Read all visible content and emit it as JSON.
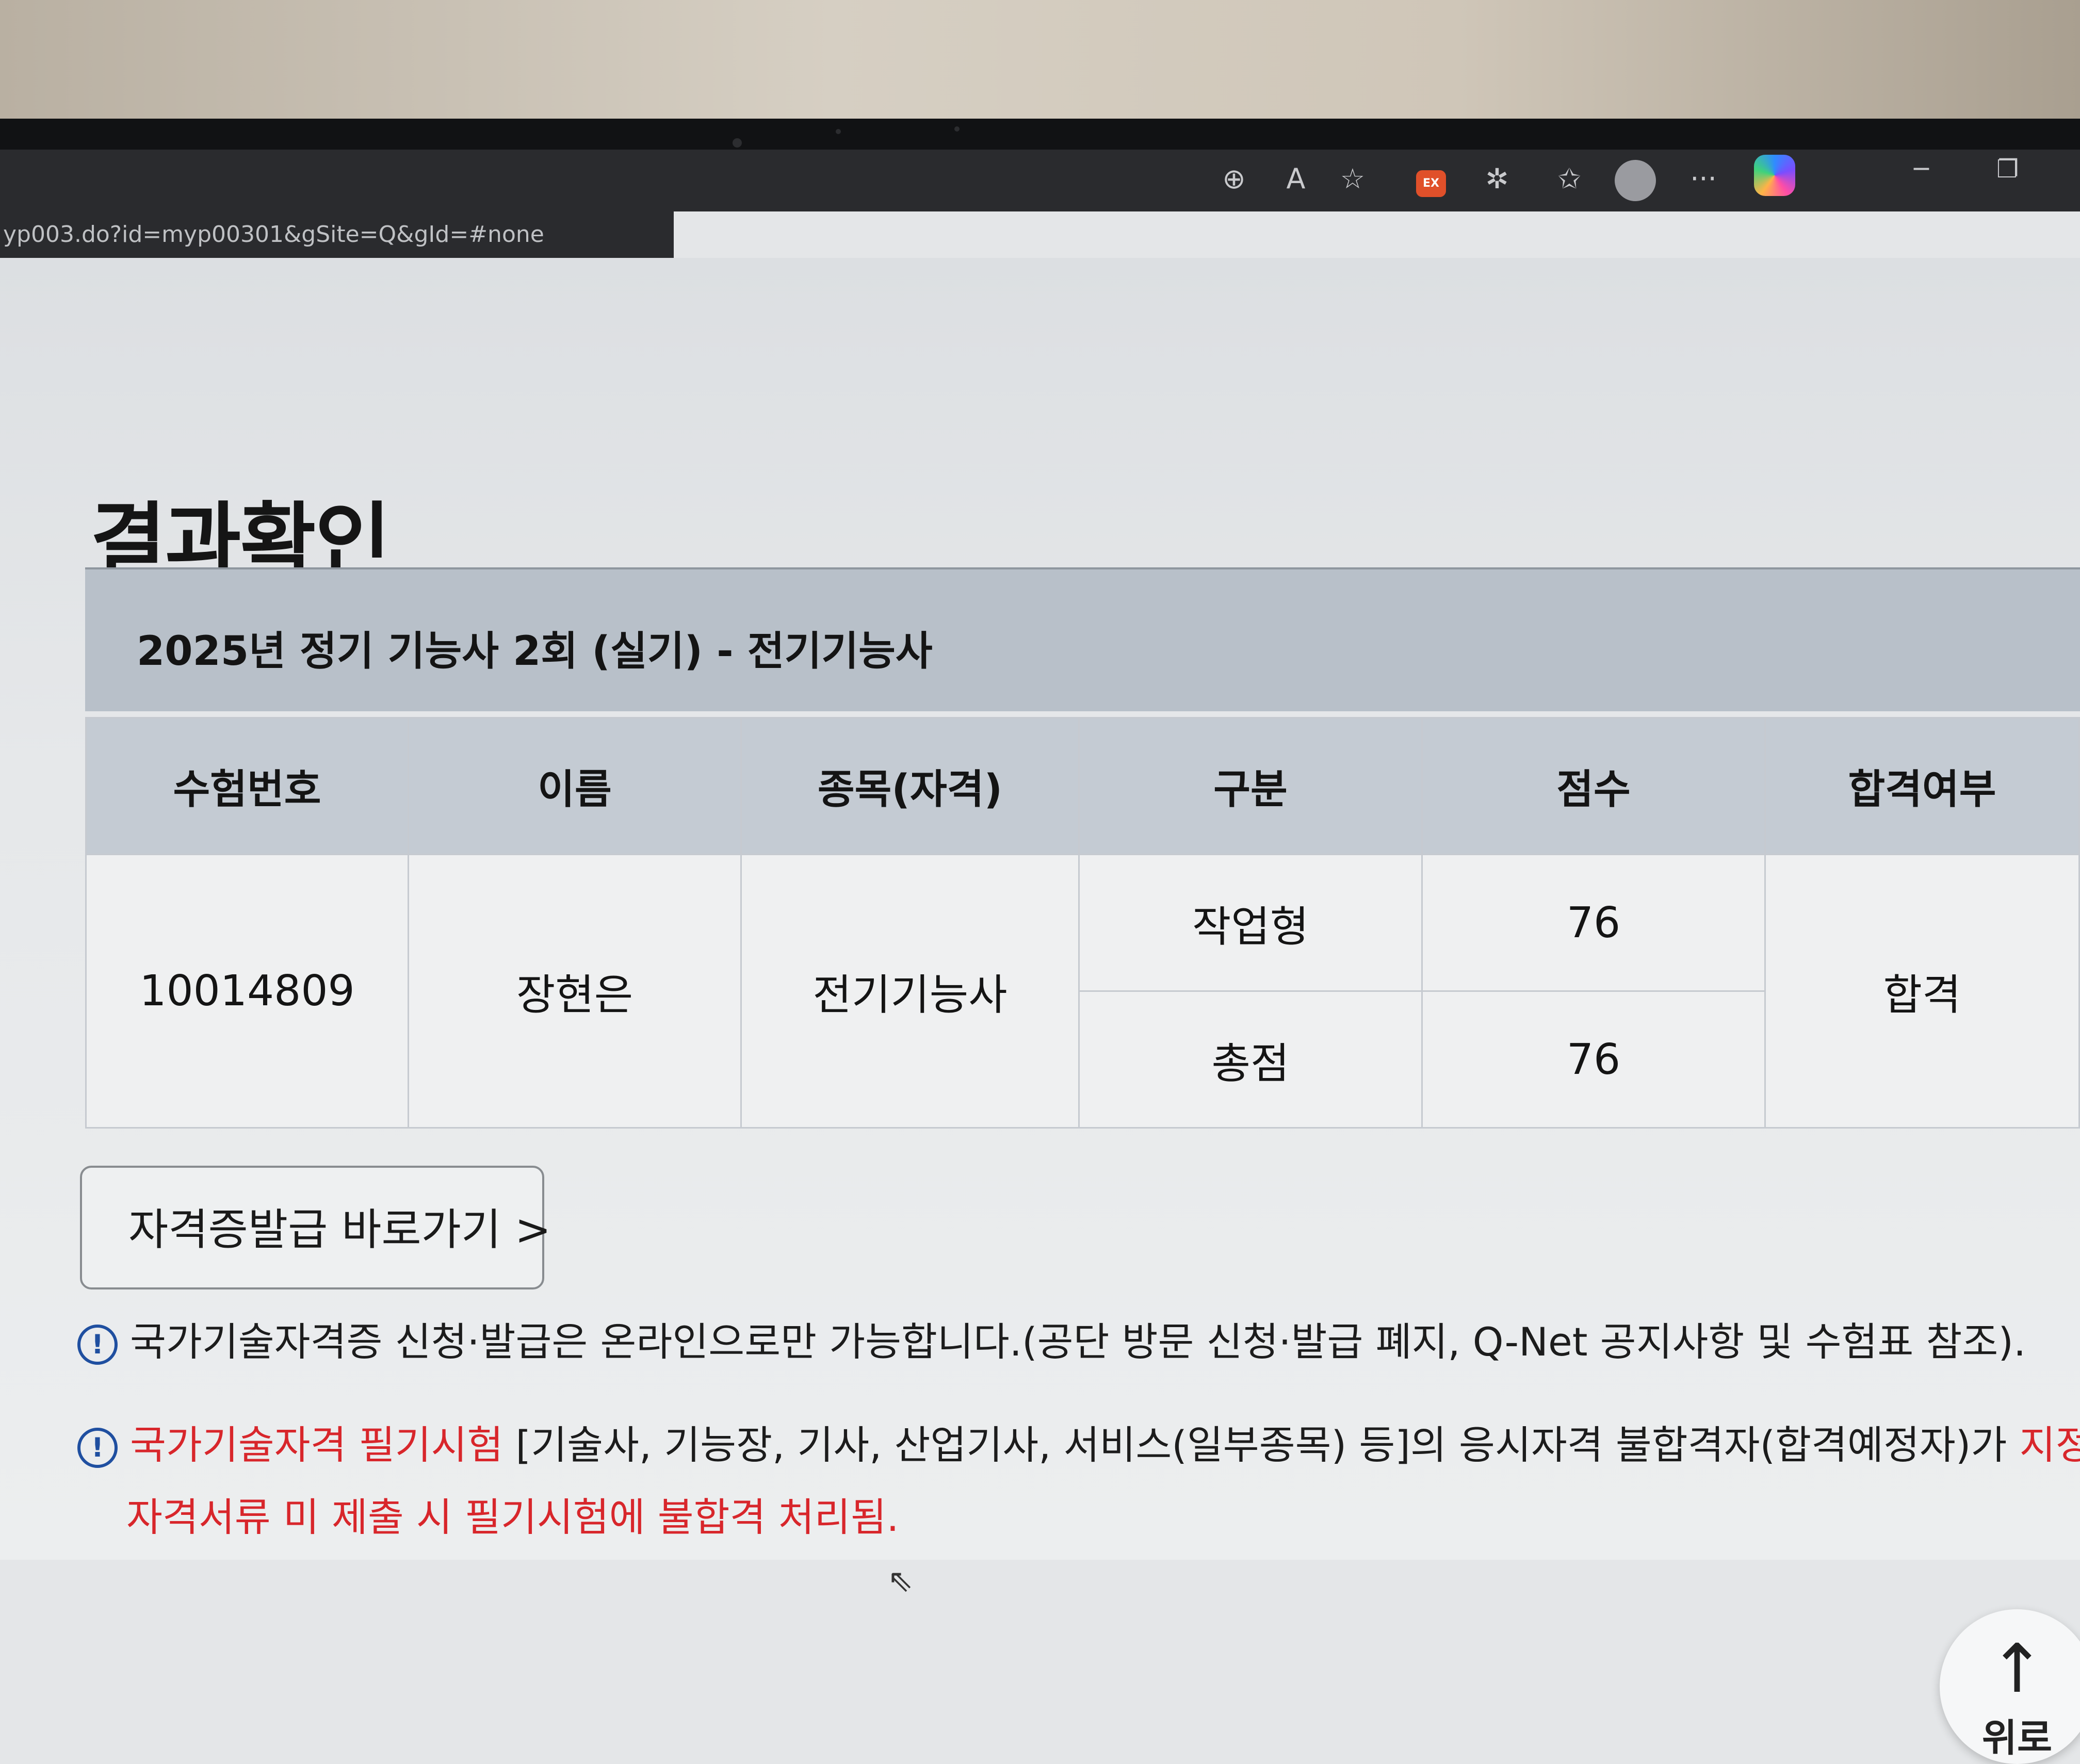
{
  "browser": {
    "address_fragment": "yp003.do?id=myp00301&gSite=Q&gId=#none",
    "extension_badge": "EX",
    "toolbar_icons": [
      "zoom-icon",
      "read-aloud-icon",
      "favorite-star-icon",
      "extension-icon",
      "puzzle-icon",
      "favorites-icon",
      "profile-icon",
      "more-icon",
      "copilot-icon"
    ],
    "more_label": "···"
  },
  "page": {
    "title": "결과확인",
    "exam_title": "2025년 정기 기능사 2회 (실기) - 전기기능사",
    "table": {
      "headers": [
        "수험번호",
        "이름",
        "종목(자격)",
        "구분",
        "점수",
        "합격여부"
      ],
      "exam_number": "10014809",
      "name": "장현은",
      "subject": "전기기능사",
      "rows": [
        {
          "category": "작업형",
          "score": "76"
        },
        {
          "category": "총점",
          "score": "76"
        }
      ],
      "result": "합격"
    },
    "cert_button": "자격증발급 바로가기 >",
    "notice1": "국가기술자격증 신청·발급은 온라인으로만 가능합니다.(공단 방문 신청·발급 폐지, Q-Net 공지사항 및 수험표 참조).",
    "notice2_red1": "국가기술자격 필기시험",
    "notice2_black": " [기술사, 기능장, 기사, 산업기사, 서비스(일부종목) 등]의 응시자격 불합격자(합격예정자)가 ",
    "notice2_red2": "지정된",
    "notice2_line2": "자격서류 미 제출 시 필기시험에 불합격 처리됨.",
    "notice_icon": "!",
    "top_button": "위로",
    "top_arrow": "↑"
  },
  "colors": {
    "accent_red": "#d8262b",
    "info_blue": "#1f4fa0",
    "header_bg": "#b8c0c9"
  }
}
